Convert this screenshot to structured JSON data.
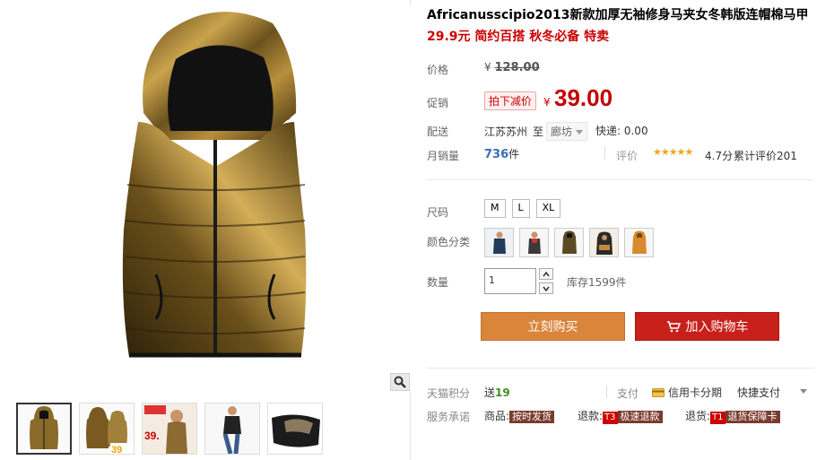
{
  "product": {
    "title": "Africanusscipio2013新款加厚无袖修身马夹女冬韩版连帽棉马甲",
    "subtitle": "29.9元 简约百搭 秋冬必备 特卖"
  },
  "price": {
    "label": "价格",
    "currency": "¥",
    "original": "128.00"
  },
  "promo": {
    "label": "促销",
    "tag": "拍下减价",
    "currency": "¥",
    "price": "39.00"
  },
  "shipping": {
    "label": "配送",
    "from": "江苏苏州",
    "to": "至",
    "destination": "廊坊",
    "fee": "快递: 0.00"
  },
  "sales": {
    "label": "月销量",
    "count": "736",
    "unit": "件"
  },
  "rating": {
    "label": "评价",
    "stars": "★★★★★",
    "score": "4.7分",
    "total": "累计评价201",
    "star_fraction": 0.94
  },
  "size": {
    "label": "尺码",
    "options": [
      "M",
      "L",
      "XL"
    ]
  },
  "color": {
    "label": "颜色分类",
    "swatches": [
      "white-coat",
      "red-scarf",
      "bronze-vest",
      "hooded-black",
      "orange-vest"
    ]
  },
  "quantity": {
    "label": "数量",
    "value": "1",
    "stock": "库存1599件"
  },
  "buttons": {
    "buy_now": "立刻购买",
    "add_to_cart": "加入购物车"
  },
  "points": {
    "label": "天猫积分",
    "prefix": "送",
    "value": "19"
  },
  "payment": {
    "label": "支付",
    "card": "信用卡分期",
    "quick": "快捷支付"
  },
  "service": {
    "label": "服务承诺",
    "items": [
      {
        "prefix": "商品:",
        "badge": "",
        "tag": "按时发货"
      },
      {
        "prefix": "退款:",
        "badge": "T3",
        "tag": "极速退款"
      },
      {
        "prefix": "退货:",
        "badge": "T1",
        "tag": "退货保障卡"
      }
    ]
  },
  "thumbnails": {
    "count": 5,
    "active_index": 0,
    "thumb_2_price": "39"
  },
  "colors": {
    "accent_red": "#c40000",
    "buy_orange": "#d9853a",
    "cart_red": "#c8201a",
    "link_blue": "#3a6db3",
    "star_gold": "#f5a31a"
  },
  "icons": {
    "zoom": "magnifier-icon",
    "cart": "cart-icon",
    "card": "credit-card-icon"
  }
}
